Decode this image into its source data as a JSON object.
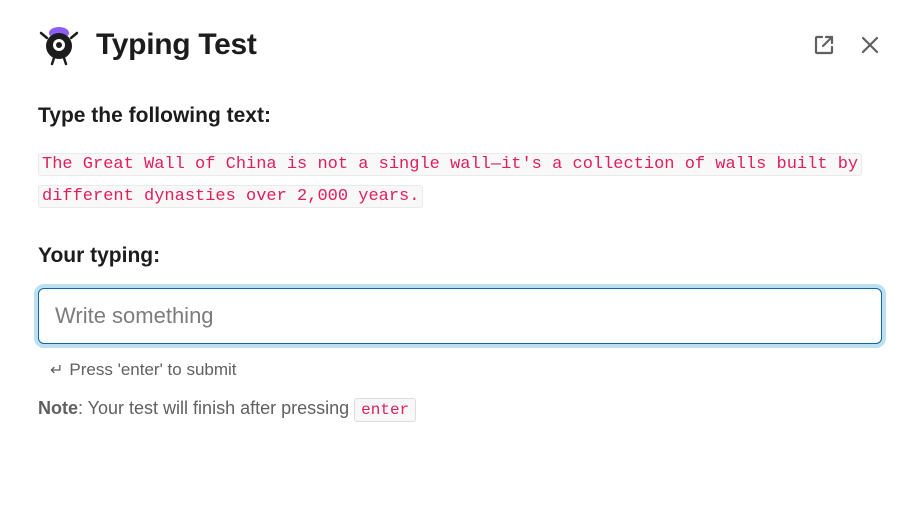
{
  "header": {
    "title": "Typing Test"
  },
  "prompt": {
    "heading": "Type the following text:",
    "target_text": "The Great Wall of China is not a single wall—it's a collection of walls built by different dynasties over 2,000 years."
  },
  "typing": {
    "heading": "Your typing:",
    "input_value": "",
    "input_placeholder": "Write something",
    "hint_text": "Press 'enter' to submit"
  },
  "note": {
    "label": "Note",
    "text": ": Your test will finish after pressing ",
    "code": "enter"
  }
}
